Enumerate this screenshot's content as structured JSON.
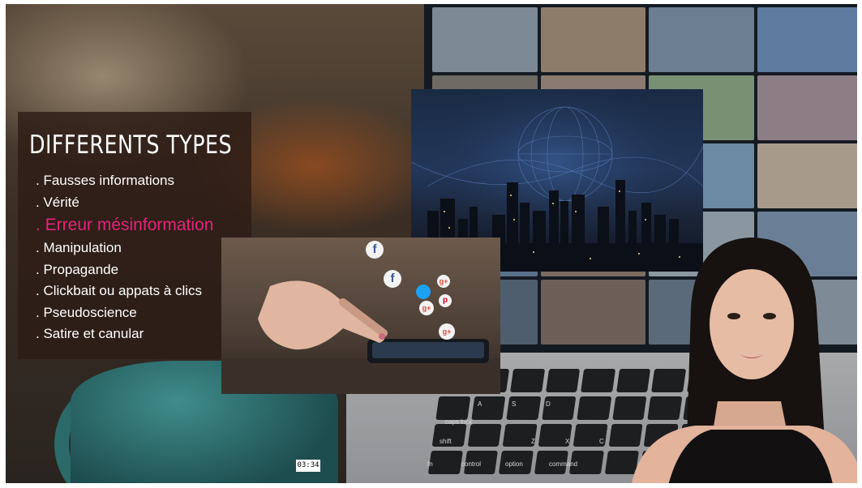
{
  "panel": {
    "title": "DIFFERENTS TYPES",
    "items": [
      ". Fausses informations",
      ". Vérité",
      ". Erreur mésinformation",
      ". Manipulation",
      ". Propagande",
      ". Clickbait ou appats à clics",
      ". Pseudoscience",
      ". Satire et canular"
    ],
    "highlight_color": "#e3247b"
  },
  "keyboard": {
    "key_labels": [
      "shift",
      "Z",
      "X",
      "C",
      "fn",
      "control",
      "option",
      "command",
      "caps lock",
      "A",
      "S",
      "D"
    ]
  },
  "video": {
    "timecode": "03:34"
  },
  "icons": [
    "facebook-icon",
    "twitter-icon",
    "google-plus-icon",
    "pinterest-icon"
  ]
}
